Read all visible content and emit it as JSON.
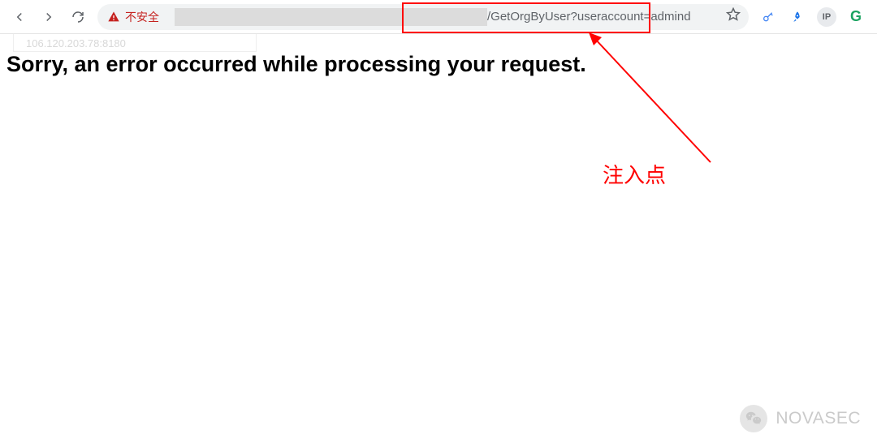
{
  "browser": {
    "insecure_label": "不安全",
    "url_visible": "/GetOrgByUser?useraccount=admind",
    "faded_subtext": "106.120.203.78:8180",
    "ip_badge": "IP",
    "g_badge": "G"
  },
  "page": {
    "error_heading": "Sorry, an error occurred while processing your request."
  },
  "annotation": {
    "label": "注入点"
  },
  "watermark": {
    "text": "NOVASEC"
  }
}
